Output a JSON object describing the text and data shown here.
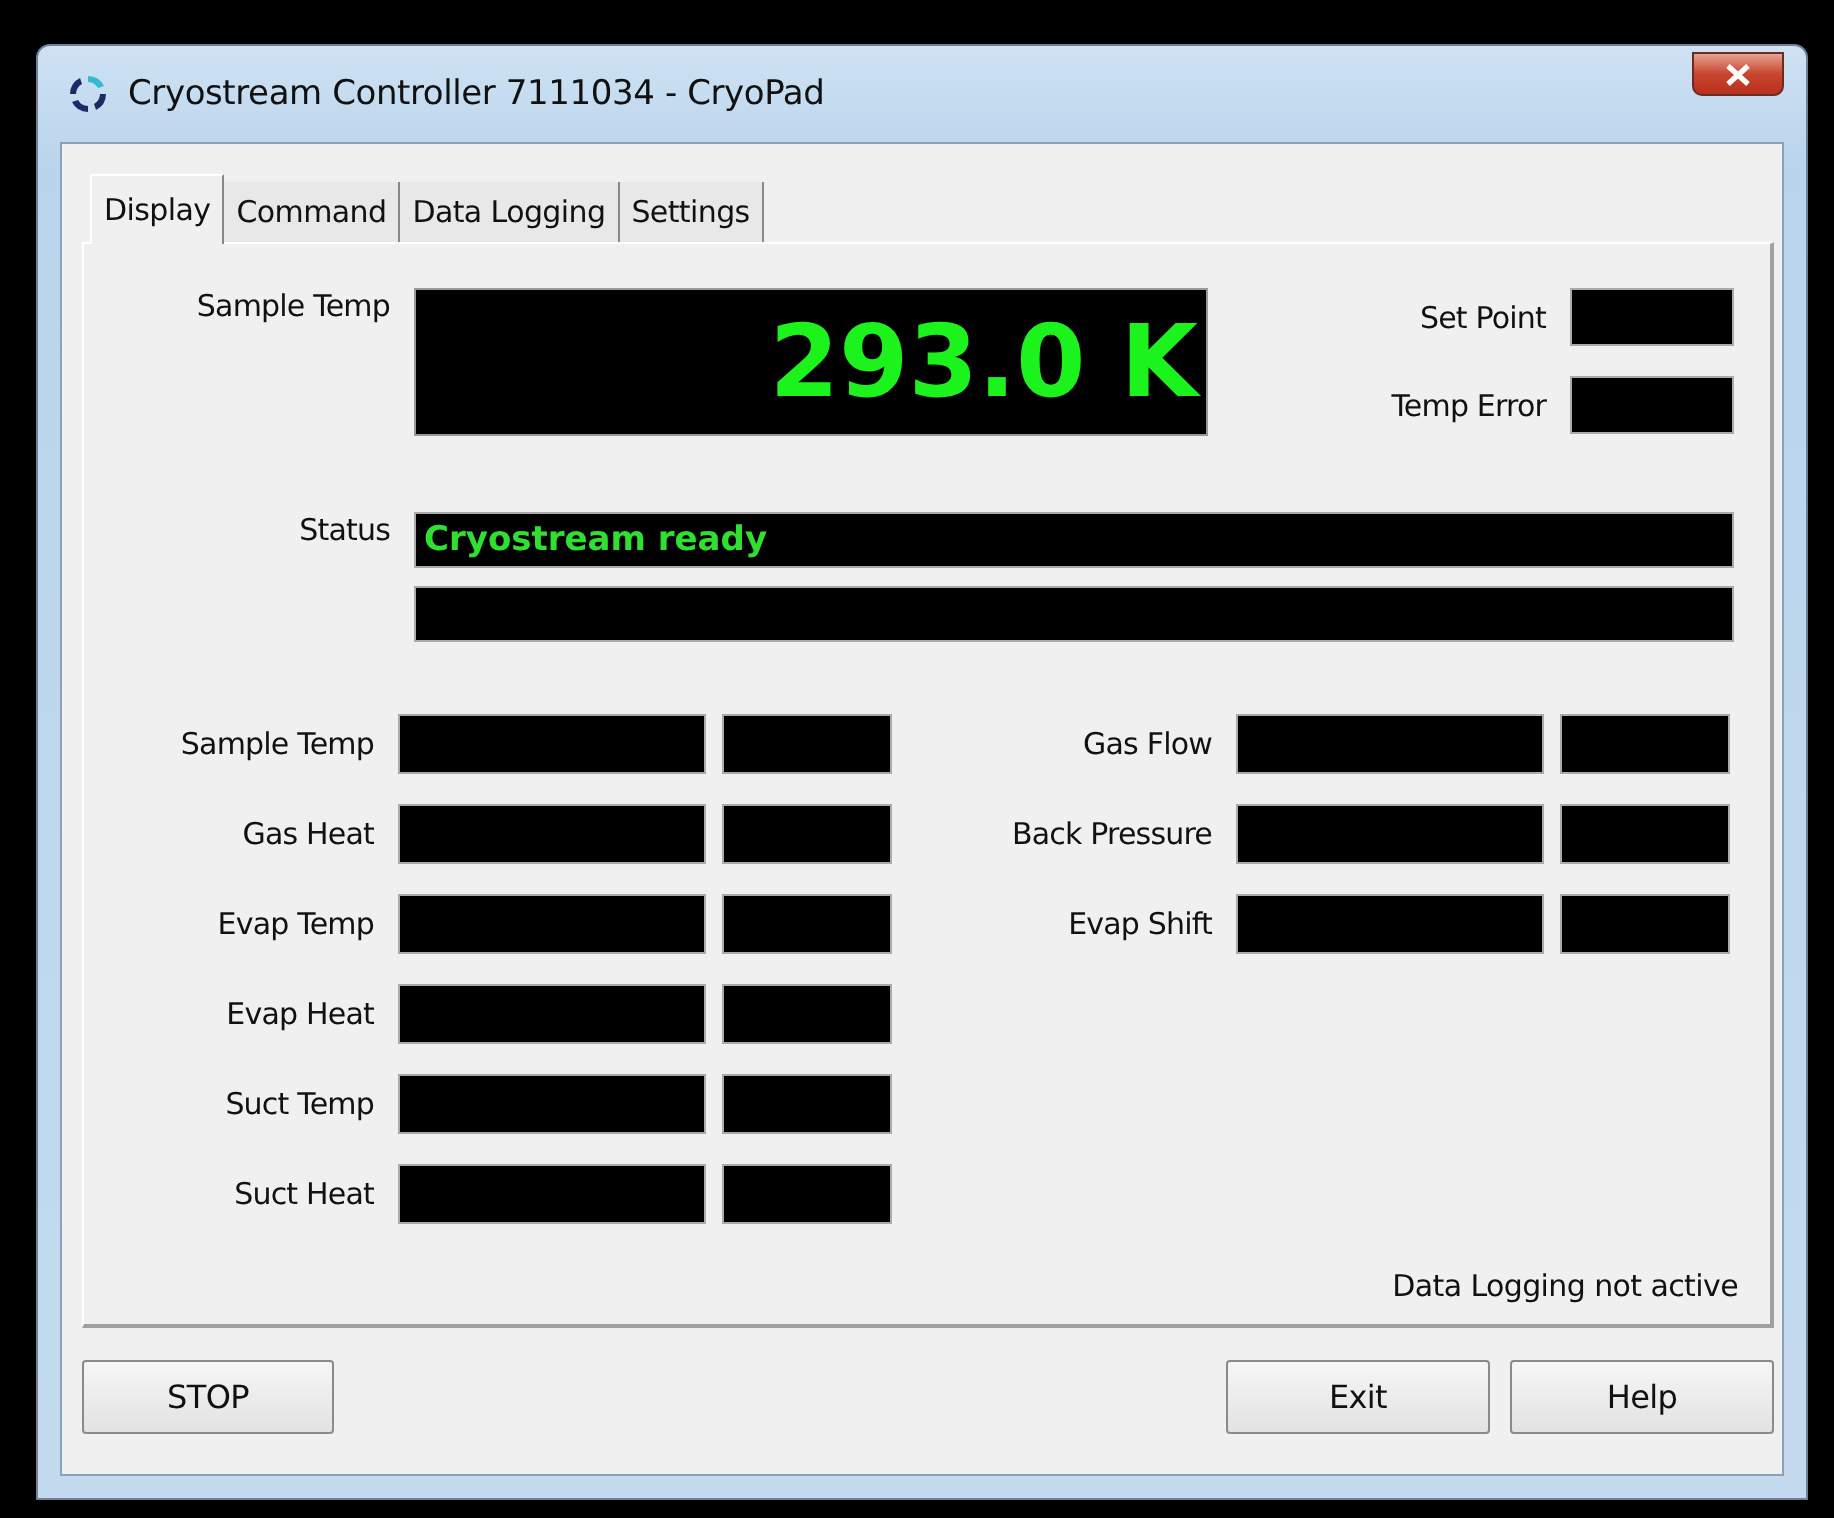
{
  "window": {
    "title": "Cryostream Controller 7111034 - CryoPad"
  },
  "tabs": [
    {
      "label": "Display",
      "selected": true
    },
    {
      "label": "Command",
      "selected": false
    },
    {
      "label": "Data Logging",
      "selected": false
    },
    {
      "label": "Settings",
      "selected": false
    }
  ],
  "main_display": {
    "label": "Sample Temp",
    "value": "293.0 K"
  },
  "side_fields": [
    {
      "label": "Set Point"
    },
    {
      "label": "Temp Error"
    }
  ],
  "status": {
    "label": "Status",
    "message": "Cryostream ready"
  },
  "readings_left": [
    {
      "label": "Sample Temp"
    },
    {
      "label": "Gas Heat"
    },
    {
      "label": "Evap Temp"
    },
    {
      "label": "Evap Heat"
    },
    {
      "label": "Suct Temp"
    },
    {
      "label": "Suct Heat"
    }
  ],
  "readings_right": [
    {
      "label": "Gas Flow"
    },
    {
      "label": "Back Pressure"
    },
    {
      "label": "Evap Shift"
    }
  ],
  "logging_status": "Data Logging not active",
  "buttons_left": [
    "STOP"
  ],
  "buttons_right": [
    "Exit",
    "Help"
  ]
}
